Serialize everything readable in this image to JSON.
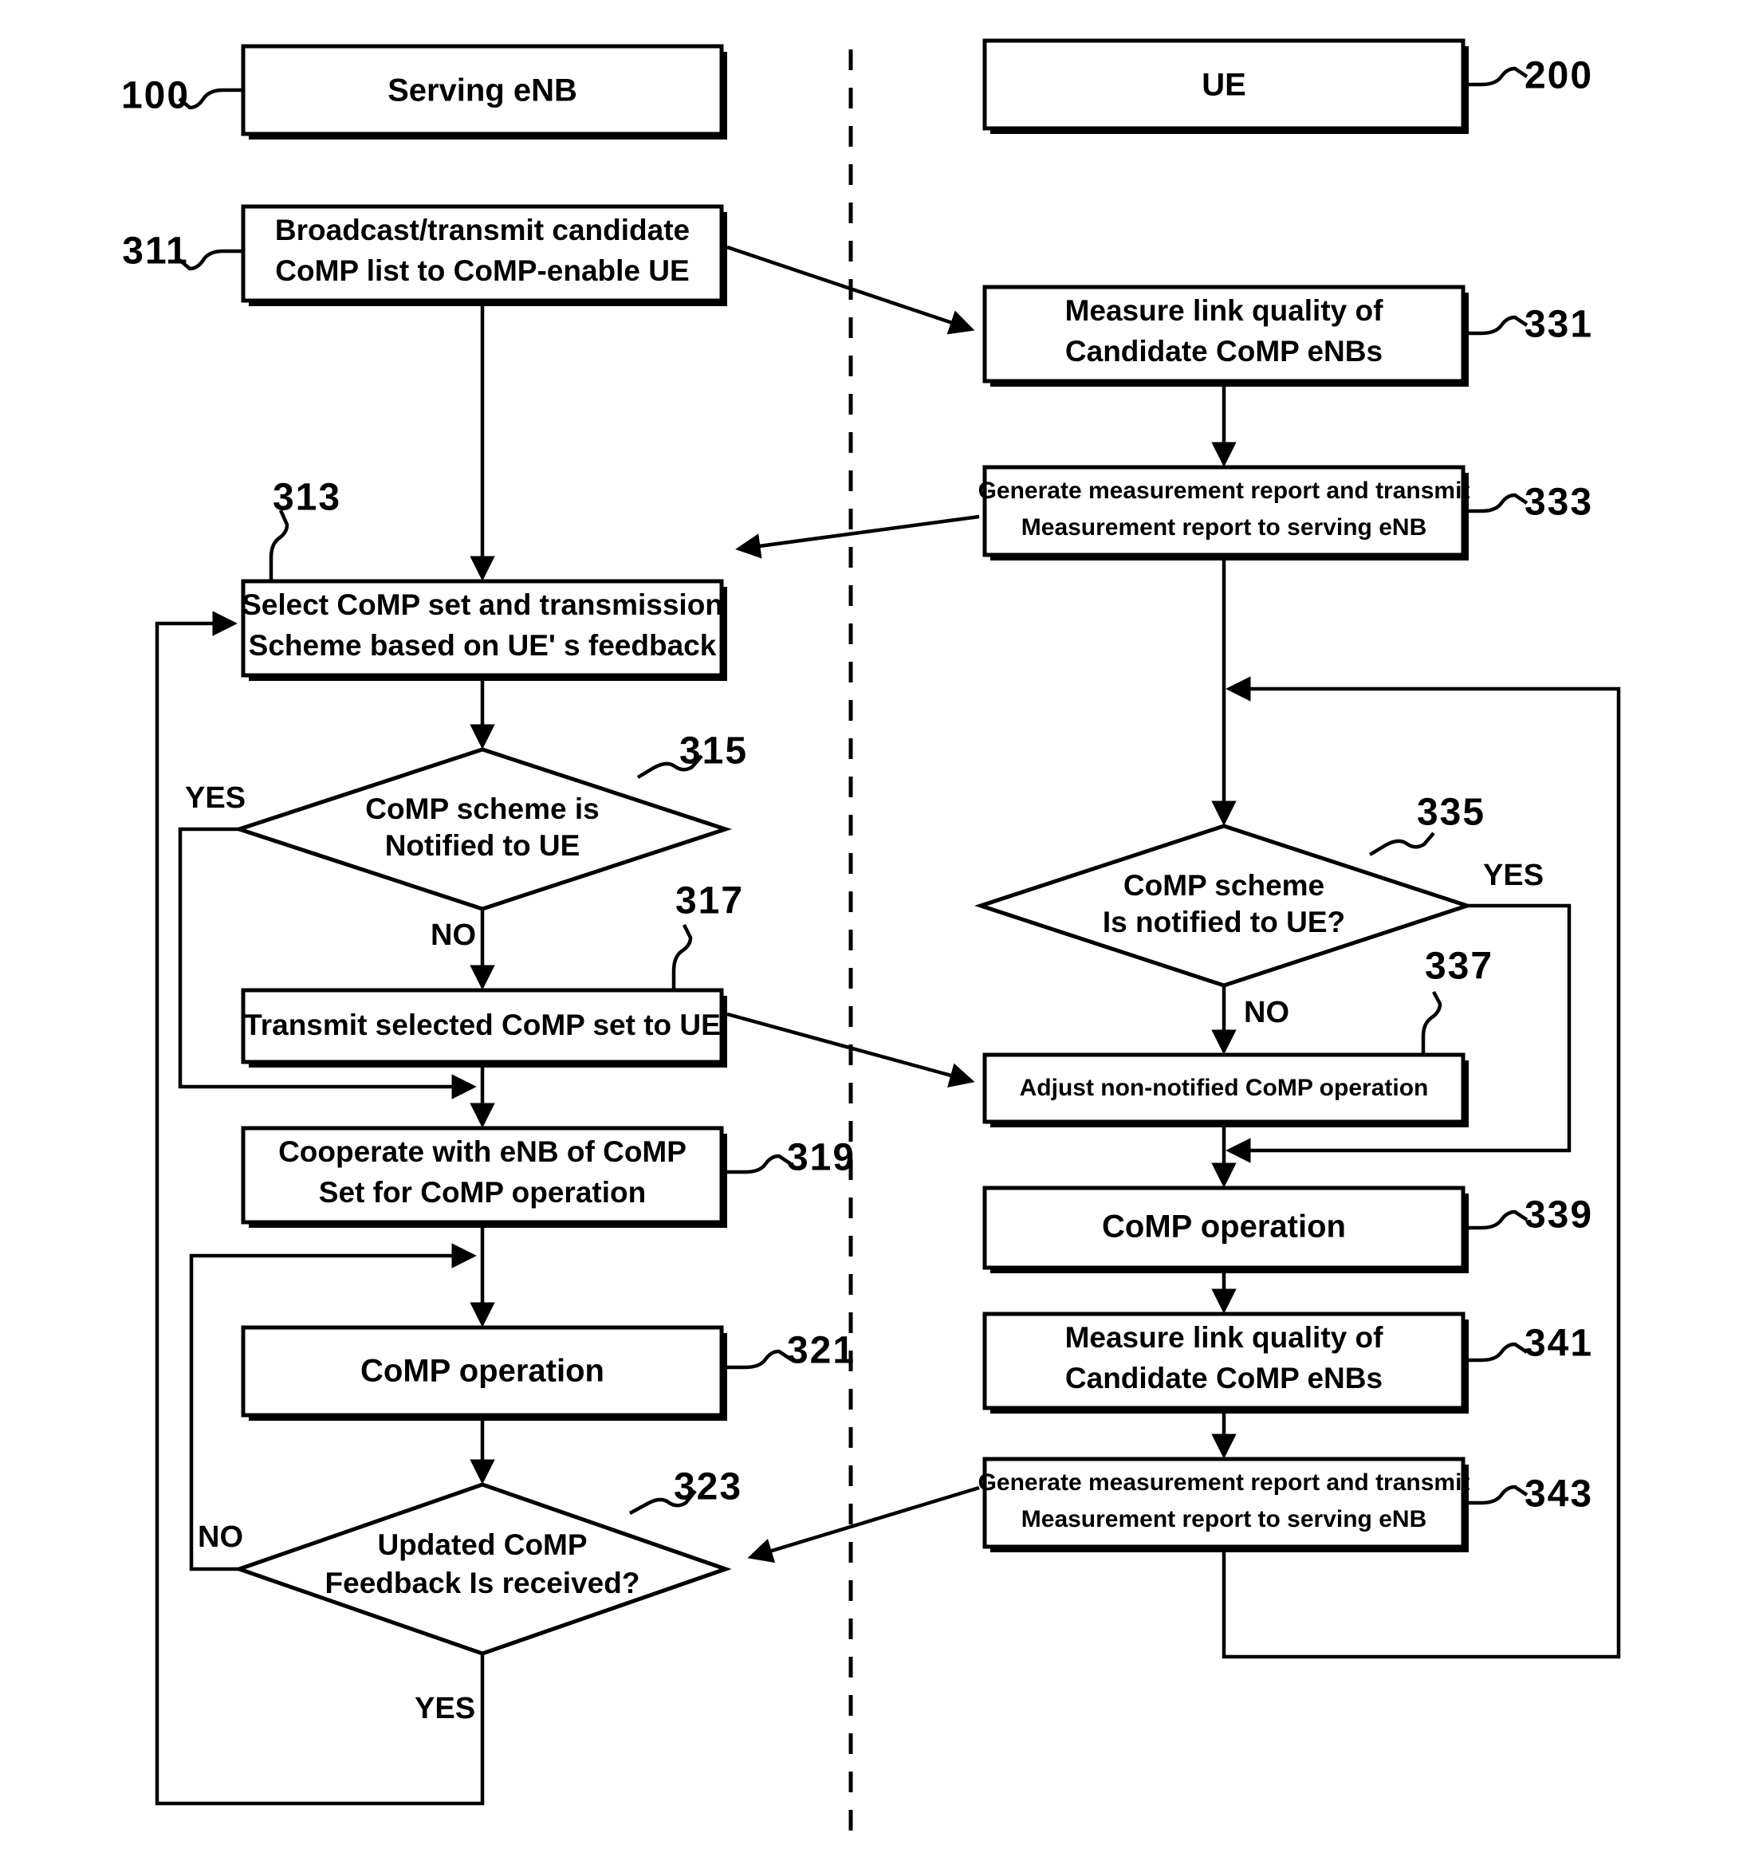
{
  "figure": {
    "lanes": [
      {
        "id": "lane-enb",
        "title": "Serving eNB",
        "ref": "100"
      },
      {
        "id": "lane-ue",
        "title": "UE",
        "ref": "200"
      }
    ],
    "steps": {
      "s311": {
        "ref": "311",
        "line1": "Broadcast/transmit candidate",
        "line2": "CoMP list to CoMP-enable UE"
      },
      "s313": {
        "ref": "313",
        "line1": "Select CoMP set and transmission",
        "line2": "Scheme based on UE'  s feedback"
      },
      "s315": {
        "ref": "315",
        "line1": "CoMP scheme is",
        "line2": "Notified to UE",
        "yes": "YES",
        "no": "NO"
      },
      "s317": {
        "ref": "317",
        "line1": "Transmit selected CoMP set to UE"
      },
      "s319": {
        "ref": "319",
        "line1": "Cooperate with eNB of CoMP",
        "line2": "Set for CoMP operation"
      },
      "s321": {
        "ref": "321",
        "line1": "CoMP operation"
      },
      "s323": {
        "ref": "323",
        "line1": "Updated CoMP",
        "line2": "Feedback Is received?",
        "no": "NO",
        "yes": "YES"
      },
      "s331": {
        "ref": "331",
        "line1": "Measure link quality of",
        "line2": "Candidate CoMP eNBs"
      },
      "s333": {
        "ref": "333",
        "line1": "Generate measurement report and transmit",
        "line2": "Measurement report to serving eNB"
      },
      "s335": {
        "ref": "335",
        "line1": "CoMP scheme",
        "line2": "Is notified to UE?",
        "yes": "YES",
        "no": "NO"
      },
      "s337": {
        "ref": "337",
        "line1": "Adjust non-notified CoMP operation"
      },
      "s339": {
        "ref": "339",
        "line1": "CoMP operation"
      },
      "s341": {
        "ref": "341",
        "line1": "Measure link quality of",
        "line2": "Candidate CoMP eNBs"
      },
      "s343": {
        "ref": "343",
        "line1": "Generate measurement report and transmit",
        "line2": "Measurement report to serving eNB"
      }
    },
    "colors": {
      "stroke": "#000000",
      "fill": "#ffffff",
      "background": "#ffffff"
    }
  }
}
